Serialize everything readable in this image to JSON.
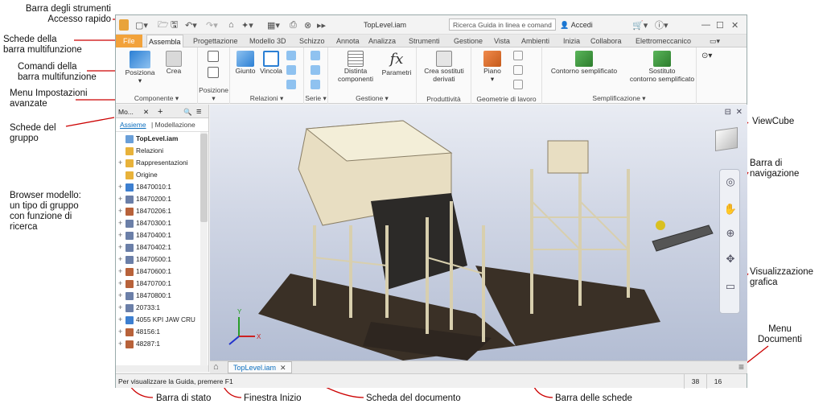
{
  "annotations": {
    "toolbar": "Barra degli strumenti\nAccesso rapido",
    "ribbon_tabs": "Schede della\nbarra multifunzione",
    "ribbon_cmds": "Comandi della\nbarra multifunzione",
    "adv_menu": "Menu Impostazioni\navanzate",
    "group_tabs": "Schede del\ngruppo",
    "browser": "Browser modello:\nun tipo di gruppo\ncon funzione di\nricerca",
    "viewcube": "ViewCube",
    "navbar": "Barra di\nnavigazione",
    "graphics": "Visualizzazione\ngrafica",
    "doc_menu": "Menu\nDocumenti",
    "status": "Barra di stato",
    "home": "Finestra Inizio",
    "doc_tab": "Scheda del documento",
    "file_tabs": "Barra delle schede"
  },
  "title": {
    "filename": "TopLevel.iam",
    "search_placeholder": "Ricerca Guida in linea e comand",
    "signin": "Accedi"
  },
  "ribbon_tabs": [
    "File",
    "Assembla",
    "Progettazione",
    "Modello 3D",
    "Schizzo",
    "Annota",
    "Analizza",
    "Strumenti",
    "Gestione",
    "Vista",
    "Ambienti",
    "Inizia",
    "Collabora",
    "Elettromeccanico"
  ],
  "ribbon_groups": {
    "componente": {
      "label": "Componente ▾",
      "cmds": [
        "Posiziona",
        "Crea"
      ]
    },
    "posizione": {
      "label": "Posizione ▾"
    },
    "relazioni": {
      "label": "Relazioni ▾",
      "cmds": [
        "Giunto",
        "Vincola"
      ]
    },
    "serie": {
      "label": "Serie ▾"
    },
    "gestione": {
      "label": "Gestione ▾",
      "cmds": [
        "Distinta\ncomponenti",
        "Parametri"
      ]
    },
    "produttivita": {
      "label": "Produttività",
      "cmds": [
        "Crea sostituti\nderivati"
      ]
    },
    "geometrie": {
      "label": "Geometrie di lavoro",
      "cmds": [
        "Piano"
      ]
    },
    "semplificazione": {
      "label": "Semplificazione ▾",
      "cmds": [
        "Contorno semplificato",
        "Sostituto\ncontorno semplificato"
      ]
    }
  },
  "browser": {
    "tab_label": "Mo...",
    "sub_tabs": [
      "Assieme",
      "Modellazione"
    ],
    "rows": [
      "TopLevel.iam",
      "Relazioni",
      "Rappresentazioni",
      "Origine",
      "18470010:1",
      "18470200:1",
      "18470206:1",
      "18470300:1",
      "18470400:1",
      "18470402:1",
      "18470500:1",
      "18470600:1",
      "18470700:1",
      "18470800:1",
      "20733:1",
      "4055 KPI JAW CRU",
      "48156:1",
      "48287:1"
    ]
  },
  "doc_tab": "TopLevel.iam",
  "status": {
    "message": "Per visualizzare la Guida, premere F1",
    "count1": "38",
    "count2": "16"
  },
  "colors": {
    "file_tab": "#f2a23a",
    "accent": "#0d6fbf"
  }
}
